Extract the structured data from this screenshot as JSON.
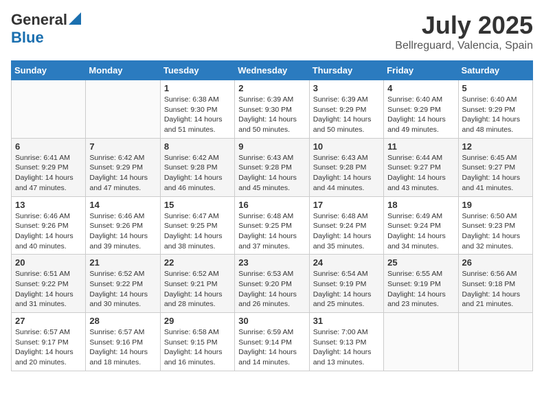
{
  "header": {
    "logo_general": "General",
    "logo_blue": "Blue",
    "title": "July 2025",
    "subtitle": "Bellreguard, Valencia, Spain"
  },
  "calendar": {
    "days_of_week": [
      "Sunday",
      "Monday",
      "Tuesday",
      "Wednesday",
      "Thursday",
      "Friday",
      "Saturday"
    ],
    "weeks": [
      [
        {
          "day": "",
          "info": ""
        },
        {
          "day": "",
          "info": ""
        },
        {
          "day": "1",
          "info": "Sunrise: 6:38 AM\nSunset: 9:30 PM\nDaylight: 14 hours and 51 minutes."
        },
        {
          "day": "2",
          "info": "Sunrise: 6:39 AM\nSunset: 9:30 PM\nDaylight: 14 hours and 50 minutes."
        },
        {
          "day": "3",
          "info": "Sunrise: 6:39 AM\nSunset: 9:29 PM\nDaylight: 14 hours and 50 minutes."
        },
        {
          "day": "4",
          "info": "Sunrise: 6:40 AM\nSunset: 9:29 PM\nDaylight: 14 hours and 49 minutes."
        },
        {
          "day": "5",
          "info": "Sunrise: 6:40 AM\nSunset: 9:29 PM\nDaylight: 14 hours and 48 minutes."
        }
      ],
      [
        {
          "day": "6",
          "info": "Sunrise: 6:41 AM\nSunset: 9:29 PM\nDaylight: 14 hours and 47 minutes."
        },
        {
          "day": "7",
          "info": "Sunrise: 6:42 AM\nSunset: 9:29 PM\nDaylight: 14 hours and 47 minutes."
        },
        {
          "day": "8",
          "info": "Sunrise: 6:42 AM\nSunset: 9:28 PM\nDaylight: 14 hours and 46 minutes."
        },
        {
          "day": "9",
          "info": "Sunrise: 6:43 AM\nSunset: 9:28 PM\nDaylight: 14 hours and 45 minutes."
        },
        {
          "day": "10",
          "info": "Sunrise: 6:43 AM\nSunset: 9:28 PM\nDaylight: 14 hours and 44 minutes."
        },
        {
          "day": "11",
          "info": "Sunrise: 6:44 AM\nSunset: 9:27 PM\nDaylight: 14 hours and 43 minutes."
        },
        {
          "day": "12",
          "info": "Sunrise: 6:45 AM\nSunset: 9:27 PM\nDaylight: 14 hours and 41 minutes."
        }
      ],
      [
        {
          "day": "13",
          "info": "Sunrise: 6:46 AM\nSunset: 9:26 PM\nDaylight: 14 hours and 40 minutes."
        },
        {
          "day": "14",
          "info": "Sunrise: 6:46 AM\nSunset: 9:26 PM\nDaylight: 14 hours and 39 minutes."
        },
        {
          "day": "15",
          "info": "Sunrise: 6:47 AM\nSunset: 9:25 PM\nDaylight: 14 hours and 38 minutes."
        },
        {
          "day": "16",
          "info": "Sunrise: 6:48 AM\nSunset: 9:25 PM\nDaylight: 14 hours and 37 minutes."
        },
        {
          "day": "17",
          "info": "Sunrise: 6:48 AM\nSunset: 9:24 PM\nDaylight: 14 hours and 35 minutes."
        },
        {
          "day": "18",
          "info": "Sunrise: 6:49 AM\nSunset: 9:24 PM\nDaylight: 14 hours and 34 minutes."
        },
        {
          "day": "19",
          "info": "Sunrise: 6:50 AM\nSunset: 9:23 PM\nDaylight: 14 hours and 32 minutes."
        }
      ],
      [
        {
          "day": "20",
          "info": "Sunrise: 6:51 AM\nSunset: 9:22 PM\nDaylight: 14 hours and 31 minutes."
        },
        {
          "day": "21",
          "info": "Sunrise: 6:52 AM\nSunset: 9:22 PM\nDaylight: 14 hours and 30 minutes."
        },
        {
          "day": "22",
          "info": "Sunrise: 6:52 AM\nSunset: 9:21 PM\nDaylight: 14 hours and 28 minutes."
        },
        {
          "day": "23",
          "info": "Sunrise: 6:53 AM\nSunset: 9:20 PM\nDaylight: 14 hours and 26 minutes."
        },
        {
          "day": "24",
          "info": "Sunrise: 6:54 AM\nSunset: 9:19 PM\nDaylight: 14 hours and 25 minutes."
        },
        {
          "day": "25",
          "info": "Sunrise: 6:55 AM\nSunset: 9:19 PM\nDaylight: 14 hours and 23 minutes."
        },
        {
          "day": "26",
          "info": "Sunrise: 6:56 AM\nSunset: 9:18 PM\nDaylight: 14 hours and 21 minutes."
        }
      ],
      [
        {
          "day": "27",
          "info": "Sunrise: 6:57 AM\nSunset: 9:17 PM\nDaylight: 14 hours and 20 minutes."
        },
        {
          "day": "28",
          "info": "Sunrise: 6:57 AM\nSunset: 9:16 PM\nDaylight: 14 hours and 18 minutes."
        },
        {
          "day": "29",
          "info": "Sunrise: 6:58 AM\nSunset: 9:15 PM\nDaylight: 14 hours and 16 minutes."
        },
        {
          "day": "30",
          "info": "Sunrise: 6:59 AM\nSunset: 9:14 PM\nDaylight: 14 hours and 14 minutes."
        },
        {
          "day": "31",
          "info": "Sunrise: 7:00 AM\nSunset: 9:13 PM\nDaylight: 14 hours and 13 minutes."
        },
        {
          "day": "",
          "info": ""
        },
        {
          "day": "",
          "info": ""
        }
      ]
    ]
  }
}
